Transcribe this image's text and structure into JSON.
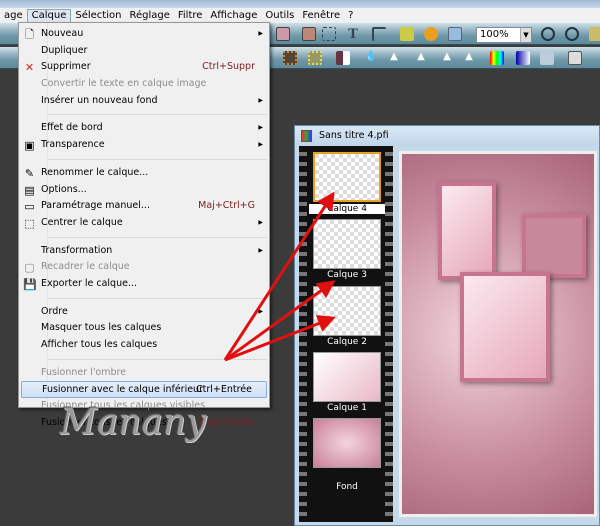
{
  "menubar": [
    "age",
    "Calque",
    "Sélection",
    "Réglage",
    "Filtre",
    "Affichage",
    "Outils",
    "Fenêtre",
    "?"
  ],
  "toolbar": {
    "zoom": "100%"
  },
  "menu": {
    "items": [
      {
        "label": "Nouveau",
        "icon": "new-page-icon",
        "submenu": true
      },
      {
        "label": "Dupliquer"
      },
      {
        "label": "Supprimer",
        "shortcut": "Ctrl+Suppr",
        "icon": "delete-x-icon"
      },
      {
        "label": "Convertir le texte en calque image",
        "disabled": true
      },
      {
        "label": "Insérer un nouveau fond",
        "submenu": true
      },
      {
        "label": "Effet de bord",
        "submenu": true
      },
      {
        "label": "Transparence",
        "icon": "transparency-icon",
        "submenu": true
      },
      {
        "label": "Renommer le calque...",
        "icon": "rename-icon"
      },
      {
        "label": "Options...",
        "icon": "options-icon"
      },
      {
        "label": "Paramétrage manuel...",
        "shortcut": "Maj+Ctrl+G",
        "icon": "manual-settings-icon"
      },
      {
        "label": "Centrer le calque",
        "icon": "center-icon",
        "submenu": true
      },
      {
        "label": "Transformation",
        "submenu": true
      },
      {
        "label": "Recadrer le calque",
        "disabled": true,
        "icon": "crop-icon"
      },
      {
        "label": "Exporter le calque...",
        "icon": "save-disk-icon"
      },
      {
        "label": "Ordre",
        "submenu": true
      },
      {
        "label": "Masquer tous les calques"
      },
      {
        "label": "Afficher tous les calques"
      },
      {
        "label": "Fusionner l'ombre",
        "disabled": true
      },
      {
        "label": "Fusionner avec le calque inférieur",
        "shortcut": "Ctrl+Entrée",
        "highlighted": true
      },
      {
        "label": "Fusionner tous les calques visibles",
        "disabled": true
      },
      {
        "label": "Fusionner tous les calques",
        "shortcut": "Maj+Entrée"
      }
    ]
  },
  "document": {
    "title": "Sans titre 4.pfi",
    "layers": [
      "Calque 4",
      "Calque 3",
      "Calque 2",
      "Calque 1",
      "Fond"
    ],
    "selected_layer": "Calque 4"
  },
  "watermark": "Manany",
  "colors": {
    "arrow": "#e01010",
    "highlight": "#cfe0f5",
    "canvas_pink": "#c78c9e"
  }
}
